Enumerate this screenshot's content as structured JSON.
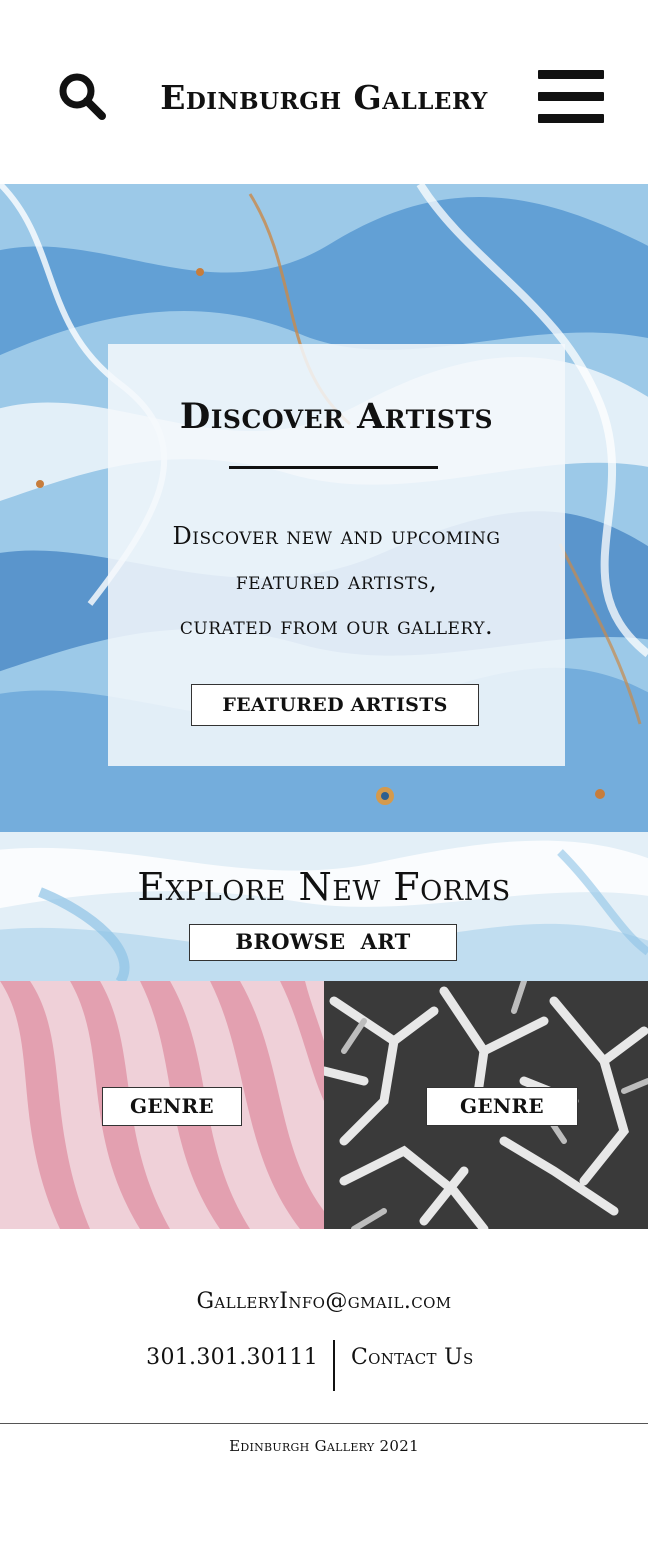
{
  "header": {
    "brand": "Edinburgh Gallery",
    "search_icon": "search-icon",
    "menu_icon": "hamburger-menu-icon"
  },
  "hero": {
    "title": "Discover Artists",
    "text_line1": "Discover new and upcoming",
    "text_line2": "featured artists,",
    "text_line3": "curated from our gallery.",
    "button_label": "FEATURED ARTISTS"
  },
  "explore": {
    "title": "Explore New Forms",
    "button_label": "BROWSE  ART"
  },
  "genres": [
    {
      "label": "GENRE",
      "image": "pink-marble-stripes"
    },
    {
      "label": "GENRE",
      "image": "white-antler-sculpture"
    }
  ],
  "footer": {
    "email": "GalleryInfo@gmail.com",
    "phone": "301.301.30111",
    "contact": "Contact Us",
    "copyright": "Edinburgh Gallery 2021"
  },
  "colors": {
    "marble_blue": "#5b9bd5",
    "marble_light": "#dcebf5",
    "marble_orange": "#c98a4a",
    "pink_stripe": "#e3a0b0",
    "text": "#111111"
  }
}
